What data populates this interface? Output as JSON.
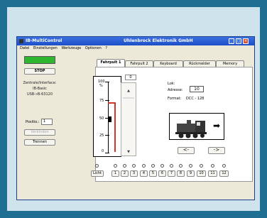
{
  "window": {
    "title_left": "IB-MultiControl",
    "title_center": "Uhlenbrock Elektronik GmbH"
  },
  "menu": [
    "Datei",
    "Einstellungen",
    "Werkzeuge",
    "Optionen",
    "?"
  ],
  "left": {
    "stop": "STOP",
    "interface_label": "Zentrale/Interface:",
    "interface_name": "IB-Basic",
    "interface_port": "USB-»B-63120",
    "position_label": "Positio.:",
    "position_value": "1",
    "disabled_button": "Verbinden",
    "trennen": "Trennen"
  },
  "tabs": [
    "Fahrpult 1",
    "Fahrpult 2",
    "Keyboard",
    "Rückmelder",
    "Memory"
  ],
  "throttle": {
    "speed_value": "0",
    "scale": [
      "100",
      "%",
      "75",
      "50",
      "25",
      "0"
    ]
  },
  "lok": {
    "heading": "Lok:",
    "address_label": "Adresse:",
    "address_value": "10",
    "format_label": "Format:",
    "format_value": "DCC - 128",
    "direction": "➡"
  },
  "direction_buttons": [
    "<-",
    "->"
  ],
  "functions": [
    "Licht",
    "1",
    "2",
    "3",
    "4",
    "5",
    "6",
    "7",
    "8",
    "9",
    "10",
    "11",
    "12"
  ],
  "colors": {
    "status_green": "#2eb62e",
    "titlebar_blue": "#1c4fc8",
    "speed_marker": "#d3332c"
  }
}
